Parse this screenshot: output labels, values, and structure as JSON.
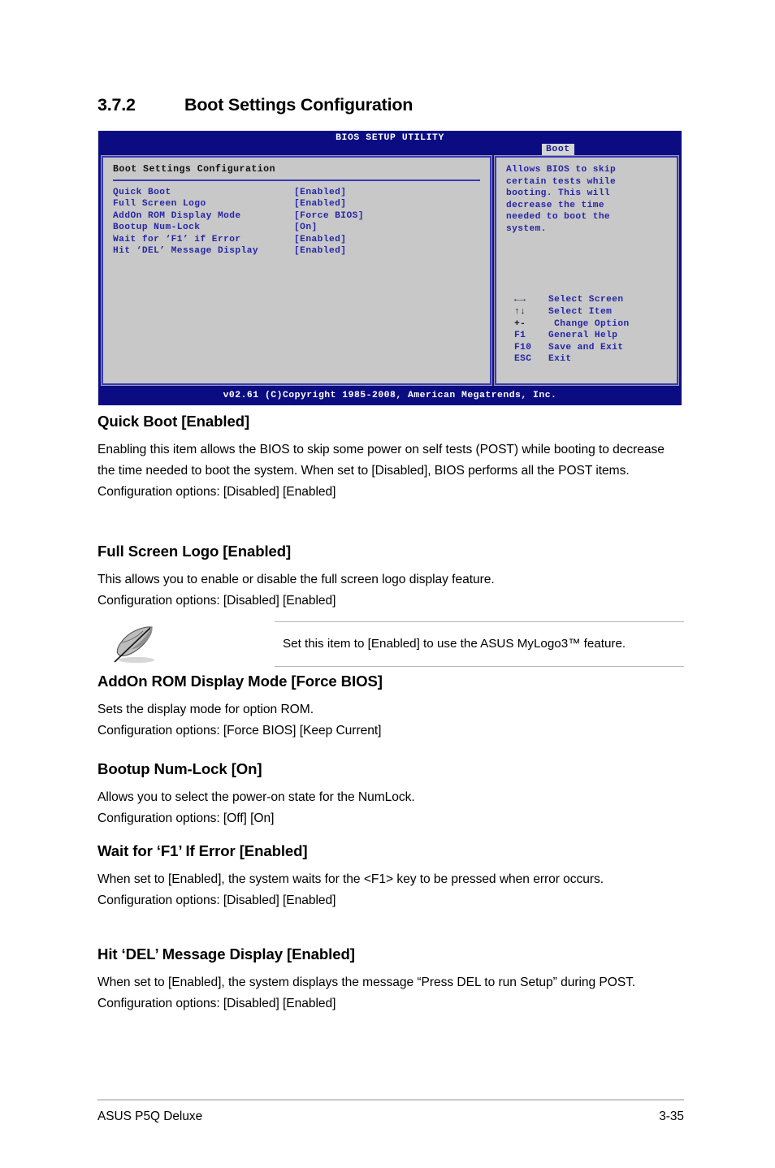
{
  "section": {
    "number": "3.7.2",
    "title": "Boot Settings Configuration"
  },
  "bios": {
    "utility_title": "BIOS SETUP UTILITY",
    "active_tab": "Boot",
    "panel_title": "Boot Settings Configuration",
    "options": [
      {
        "name": "Quick Boot",
        "value": "[Enabled]"
      },
      {
        "name": "Full Screen Logo",
        "value": "[Enabled]"
      },
      {
        "name": "AddOn ROM Display Mode",
        "value": "[Force BIOS]"
      },
      {
        "name": "Bootup Num-Lock",
        "value": "[On]"
      },
      {
        "name": "Wait for ‘F1’ if Error",
        "value": "[Enabled]"
      },
      {
        "name": "Hit ‘DEL’ Message Display",
        "value": "[Enabled]"
      }
    ],
    "help_text": "Allows BIOS to skip\ncertain tests while\nbooting. This will\ndecrease the time\nneeded to boot the\nsystem.",
    "legend": [
      {
        "key": "←→",
        "label": "Select Screen",
        "icon": "left-right-arrow-icon"
      },
      {
        "key": "↑↓",
        "label": "Select Item",
        "icon": "up-down-arrow-icon"
      },
      {
        "key": "+-",
        "label": " Change Option",
        "icon": "plus-minus-icon"
      },
      {
        "key": "F1",
        "label": "General Help",
        "icon": "key-f1"
      },
      {
        "key": "F10",
        "label": "Save and Exit",
        "icon": "key-f10"
      },
      {
        "key": "ESC",
        "label": "Exit",
        "icon": "key-esc"
      }
    ],
    "footer": "v02.61 (C)Copyright 1985-2008, American Megatrends, Inc.",
    "colors": {
      "chrome_blue": "#0c0c82",
      "panel_gray": "#c8c8c8",
      "text_blue": "#2525a8",
      "tab_bg": "#d4d4d4"
    }
  },
  "items": [
    {
      "heading": "Quick Boot [Enabled]",
      "body": "Enabling this item allows the BIOS to skip some power on self tests (POST) while booting to decrease the time needed to boot the system. When set to [Disabled], BIOS performs all the POST items.\nConfiguration options: [Disabled] [Enabled]"
    },
    {
      "heading": "Full Screen Logo [Enabled]",
      "body": "This allows you to enable or disable the full screen logo display feature.\nConfiguration options: [Disabled] [Enabled]"
    },
    {
      "heading": "AddOn ROM Display Mode [Force BIOS]",
      "body": "Sets the display mode for option ROM.\nConfiguration options: [Force BIOS] [Keep Current]"
    },
    {
      "heading": "Bootup Num-Lock [On]",
      "body": "Allows you to select the power-on state for the NumLock.\nConfiguration options: [Off] [On]"
    },
    {
      "heading": "Wait for ‘F1’ If Error [Enabled]",
      "body": "When set to [Enabled], the system waits for the <F1> key to be pressed when error occurs.\nConfiguration options: [Disabled] [Enabled]"
    },
    {
      "heading": "Hit ‘DEL’ Message Display [Enabled]",
      "body": "When set to [Enabled], the system displays the message “Press DEL to run Setup” during POST.\nConfiguration options: [Disabled] [Enabled]"
    }
  ],
  "note": {
    "icon": "quill-pen-icon",
    "text": "Set this item to [Enabled] to use the ASUS MyLogo3™ feature."
  },
  "page_footer": {
    "left": "ASUS P5Q Deluxe",
    "right": "3-35"
  }
}
